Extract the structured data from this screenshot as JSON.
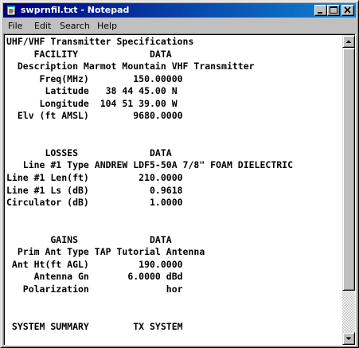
{
  "window": {
    "title": "swprnfil.txt - Notepad",
    "icon": "notepad-icon",
    "controls": [
      "minimize-icon",
      "maximize-icon",
      "close-icon"
    ]
  },
  "menu": {
    "file": "File",
    "edit": "Edit",
    "search": "Search",
    "help": "Help"
  },
  "document": {
    "lines": [
      "UHF/VHF Transmitter Specifications",
      "     FACILITY             DATA",
      "  Description Marmot Mountain VHF Transmitter",
      "      Freq(MHz)        150.00000",
      "       Latitude   38 44 45.00 N",
      "      Longitude  104 51 39.00 W",
      "  Elv (ft AMSL)        9680.0000",
      "",
      "",
      "       LOSSES             DATA",
      "   Line #1 Type ANDREW LDF5-50A 7/8\" FOAM DIELECTRIC",
      "Line #1 Len(ft)         210.0000",
      "Line #1 Ls (dB)           0.9618",
      "Circulator (dB)           1.0000",
      "",
      "",
      "        GAINS             DATA",
      "  Prim Ant Type TAP Tutorial Antenna",
      " Ant Ht(ft AGL)         190.0000",
      "     Antenna Gn       6.0000 dBd",
      "   Polarization              hor",
      "",
      "",
      " SYSTEM SUMMARY        TX SYSTEM"
    ]
  },
  "scrollbar": {
    "up_icon": "arrow-up-icon",
    "down_icon": "arrow-down-icon"
  }
}
